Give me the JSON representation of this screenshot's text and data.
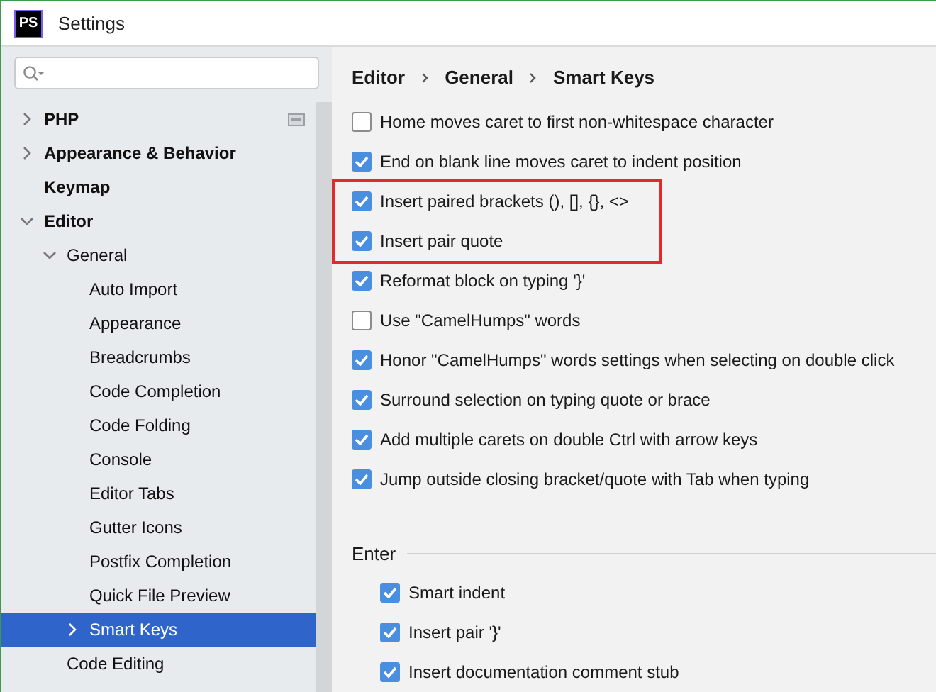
{
  "window": {
    "title": "Settings",
    "app_icon": "PS"
  },
  "sidebar": {
    "items": [
      {
        "label": "PHP",
        "bold": true,
        "expanded": false,
        "selected": false,
        "project_badge": true
      },
      {
        "label": "Appearance & Behavior",
        "bold": true,
        "expanded": false,
        "selected": false
      },
      {
        "label": "Keymap",
        "bold": true,
        "selected": false
      },
      {
        "label": "Editor",
        "bold": true,
        "expanded": true,
        "selected": false,
        "children": [
          {
            "label": "General",
            "expanded": true,
            "selected": false,
            "children": [
              {
                "label": "Auto Import",
                "selected": false
              },
              {
                "label": "Appearance",
                "selected": false
              },
              {
                "label": "Breadcrumbs",
                "selected": false
              },
              {
                "label": "Code Completion",
                "selected": false
              },
              {
                "label": "Code Folding",
                "selected": false
              },
              {
                "label": "Console",
                "selected": false
              },
              {
                "label": "Editor Tabs",
                "selected": false
              },
              {
                "label": "Gutter Icons",
                "selected": false
              },
              {
                "label": "Postfix Completion",
                "selected": false
              },
              {
                "label": "Quick File Preview",
                "selected": false
              },
              {
                "label": "Smart Keys",
                "expanded": false,
                "selected": true
              }
            ]
          },
          {
            "label": "Code Editing",
            "selected": false
          }
        ]
      }
    ]
  },
  "breadcrumb": [
    "Editor",
    "General",
    "Smart Keys"
  ],
  "option_groups": [
    {
      "highlighted": false,
      "options": [
        {
          "label": "Home moves caret to first non-whitespace character",
          "checked": false
        },
        {
          "label": "End on blank line moves caret to indent position",
          "checked": true
        }
      ]
    },
    {
      "highlighted": true,
      "options": [
        {
          "label": "Insert paired brackets (), [], {}, <>",
          "checked": true
        },
        {
          "label": "Insert pair quote",
          "checked": true
        }
      ]
    },
    {
      "highlighted": false,
      "options": [
        {
          "label": "Reformat block on typing '}'",
          "checked": true
        },
        {
          "label": "Use \"CamelHumps\" words",
          "checked": false
        },
        {
          "label": "Honor \"CamelHumps\" words settings when selecting on double click",
          "checked": true
        },
        {
          "label": "Surround selection on typing quote or brace",
          "checked": true
        },
        {
          "label": "Add multiple carets on double Ctrl with arrow keys",
          "checked": true
        },
        {
          "label": "Jump outside closing bracket/quote with Tab when typing",
          "checked": true
        }
      ]
    }
  ],
  "enter_section": {
    "title": "Enter",
    "options": [
      {
        "label": "Smart indent",
        "checked": true
      },
      {
        "label": "Insert pair '}'",
        "checked": true
      },
      {
        "label": "Insert documentation comment stub",
        "checked": true
      }
    ]
  }
}
